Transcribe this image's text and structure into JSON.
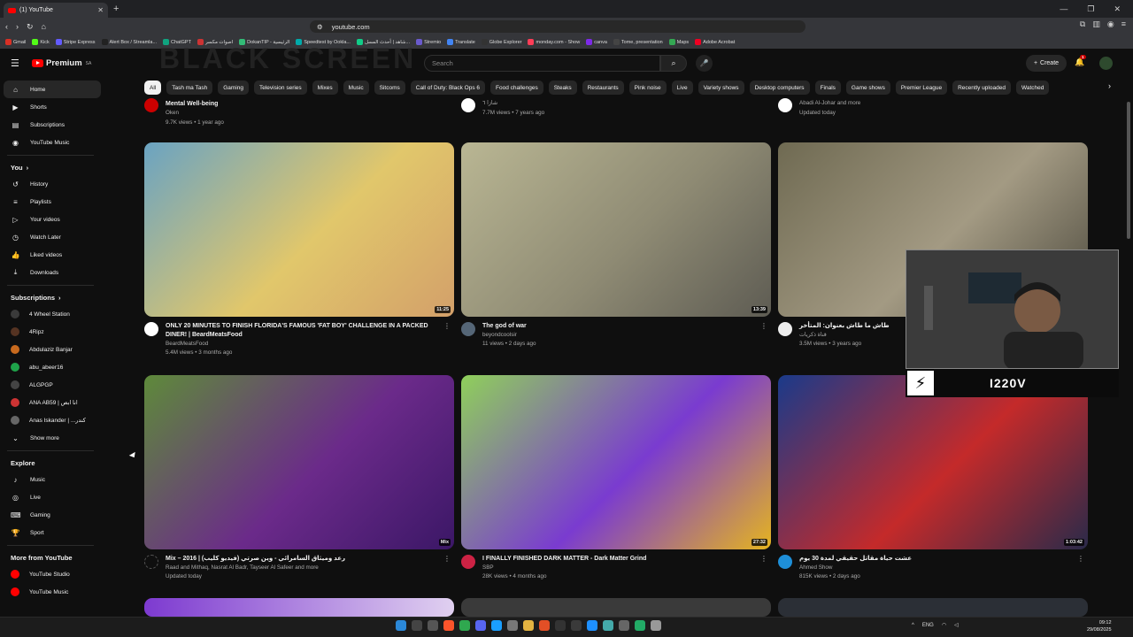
{
  "browser": {
    "tab_title": "(1) YouTube",
    "url": "youtube.com",
    "bookmarks": [
      "Gmail",
      "Kick",
      "Stripe Express",
      "Alert Box / Streamla...",
      "ChatGPT",
      "اصوات مكسر",
      "DokanTIP - الرئيسية",
      "Speedtest by Ookla...",
      "شاهد | أحدث المسل...",
      "Stremio",
      "Translate",
      "Globe Explorer",
      "monday.com - Show",
      "canva",
      "Tome, presentation",
      "Maps",
      "Adobe Acrobat"
    ]
  },
  "header": {
    "logo": "Premium",
    "region": "SA",
    "ghost_text": "BLACK SCREEN",
    "search_placeholder": "Search",
    "create_label": "Create",
    "notif_count": "1"
  },
  "sidebar": {
    "main": [
      {
        "label": "Home",
        "icon": "home-icon"
      },
      {
        "label": "Shorts",
        "icon": "shorts-icon"
      },
      {
        "label": "Subscriptions",
        "icon": "subscriptions-icon"
      },
      {
        "label": "YouTube Music",
        "icon": "music-icon"
      }
    ],
    "you_header": "You",
    "you": [
      {
        "label": "History",
        "icon": "history-icon"
      },
      {
        "label": "Playlists",
        "icon": "playlists-icon"
      },
      {
        "label": "Your videos",
        "icon": "your-videos-icon"
      },
      {
        "label": "Watch Later",
        "icon": "watch-later-icon"
      },
      {
        "label": "Liked videos",
        "icon": "liked-icon"
      },
      {
        "label": "Downloads",
        "icon": "download-icon"
      }
    ],
    "subs_header": "Subscriptions",
    "subs": [
      {
        "label": "4 Wheel Station",
        "color": "#3a3a3a"
      },
      {
        "label": "4Ripz",
        "color": "#553322"
      },
      {
        "label": "Abdulaziz Banjar",
        "color": "#c86a1e"
      },
      {
        "label": "abu_abeer16",
        "color": "#1fa34a"
      },
      {
        "label": "ALGPGP",
        "color": "#444444"
      },
      {
        "label": "ANA AB59 | انا ابص",
        "color": "#cc3333"
      },
      {
        "label": "Anas Iskander | ...كندر",
        "color": "#666666"
      }
    ],
    "show_more": "Show more",
    "explore_header": "Explore",
    "explore": [
      {
        "label": "Music",
        "icon": "music-note-icon"
      },
      {
        "label": "Live",
        "icon": "live-icon"
      },
      {
        "label": "Gaming",
        "icon": "gaming-icon"
      },
      {
        "label": "Sport",
        "icon": "trophy-icon"
      }
    ],
    "more_header": "More from YouTube",
    "more": [
      {
        "label": "YouTube Studio",
        "color": "#ff0000"
      },
      {
        "label": "YouTube Music",
        "color": "#ff0000"
      }
    ]
  },
  "chips": [
    "All",
    "Tash ma Tash",
    "Gaming",
    "Television series",
    "Mixes",
    "Music",
    "Sitcoms",
    "Call of Duty: Black Ops 6",
    "Food challenges",
    "Steaks",
    "Restaurants",
    "Pink noise",
    "Live",
    "Variety shows",
    "Desktop computers",
    "Finals",
    "Game shows",
    "Premier League",
    "Recently uploaded",
    "Watched"
  ],
  "top_partial": [
    {
      "title": "Mental Well-being",
      "channel": "Oken",
      "views": "9.7K views • 1 year ago"
    },
    {
      "title": "",
      "channel": "شازا ٦",
      "views": "7.7M views • 7 years ago"
    },
    {
      "title": "",
      "channel": "Abadi Al-Johar and more",
      "views": "Updated today"
    }
  ],
  "videos": [
    {
      "title": "ONLY 20 MINUTES TO FINISH FLORIDA'S FAMOUS 'FAT BOY' CHALLENGE IN A PACKED DINER! | BeardMeatsFood",
      "channel": "BeardMeatsFood",
      "views": "5.4M views • 3 months ago",
      "duration": "11:25",
      "colors": [
        "#6aa3c2",
        "#e1c76b",
        "#d3a06a"
      ],
      "avatar": "#ffffff"
    },
    {
      "title": "The god of war",
      "channel": "beyondcoolsir",
      "views": "11 views • 2 days ago",
      "duration": "13:39",
      "colors": [
        "#b9b693",
        "#8f8b74",
        "#5e5c53"
      ],
      "avatar": "#556677"
    },
    {
      "title": "طاش ما طاش بعنوان: المتأخر",
      "channel": "قناة ذكريات",
      "views": "3.5M views • 3 years ago",
      "duration": "",
      "colors": [
        "#6f6a52",
        "#a39a83",
        "#4d4a3e"
      ],
      "avatar": "#eeeeee"
    },
    {
      "title": "Mix – 2016 | رعد وميثاق السامرائي - وين صرتي (فيديو كليب)",
      "channel": "Raad and Mithaq, Nasrat Al Badr, Tayseer Al Safeer and more",
      "views": "Updated today",
      "duration": "Mix",
      "colors": [
        "#5e8a3a",
        "#6b2a8a",
        "#3b1766"
      ],
      "avatar": ""
    },
    {
      "title": "I FINALLY FINISHED DARK MATTER - Dark Matter Grind",
      "channel": "SBP",
      "views": "28K views • 4 months ago",
      "duration": "27:32",
      "colors": [
        "#8fd05a",
        "#7a3bd0",
        "#e5b420"
      ],
      "avatar": "#cc2244"
    },
    {
      "title": "عشت حياة مقاتل حقيقي لمدة 30 يوم",
      "channel": "Ahmed Show",
      "views": "815K views • 2 days ago",
      "duration": "1:03:42",
      "colors": [
        "#1a3a8a",
        "#c42a2a",
        "#2a2a4a"
      ],
      "avatar": "#1e8fd8"
    }
  ],
  "webcam": {
    "name": "I220V"
  },
  "taskbar": {
    "lang": "ENG",
    "time": "09:12",
    "date": "29/08/2025"
  }
}
